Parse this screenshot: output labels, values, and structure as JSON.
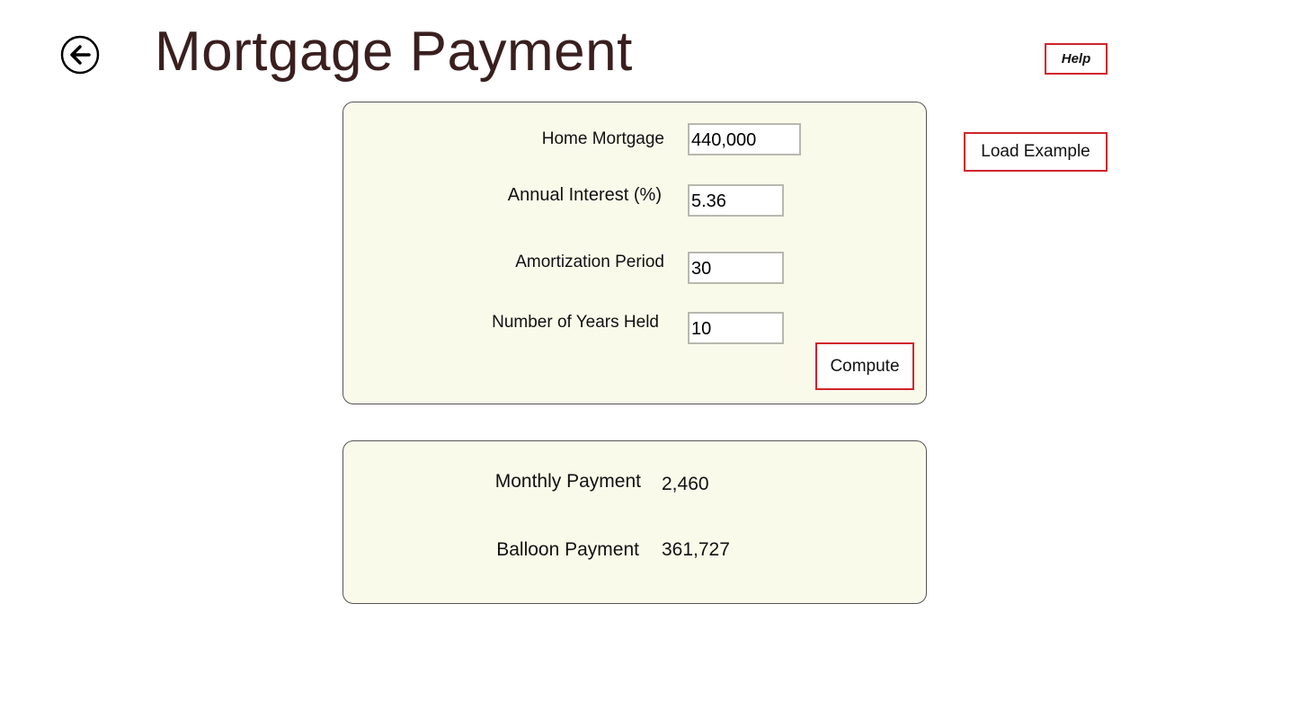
{
  "header": {
    "title": "Mortgage Payment",
    "back_icon": "back-arrow-circle-icon"
  },
  "actions": {
    "help_label": "Help",
    "load_example_label": "Load Example",
    "compute_label": "Compute"
  },
  "inputs": {
    "home_mortgage": {
      "label": "Home Mortgage",
      "value": "440,000"
    },
    "annual_interest": {
      "label": "Annual Interest (%)",
      "value": "5.36"
    },
    "amortization_period": {
      "label": "Amortization Period",
      "value": "30"
    },
    "years_held": {
      "label": "Number of Years Held",
      "value": "10"
    }
  },
  "results": {
    "monthly_payment": {
      "label": "Monthly Payment",
      "value": "2,460"
    },
    "balloon_payment": {
      "label": "Balloon Payment",
      "value": "361,727"
    }
  },
  "colors": {
    "panel_background": "#fafaeb",
    "button_border": "#d0242b",
    "title_color": "#3a1f1f"
  }
}
